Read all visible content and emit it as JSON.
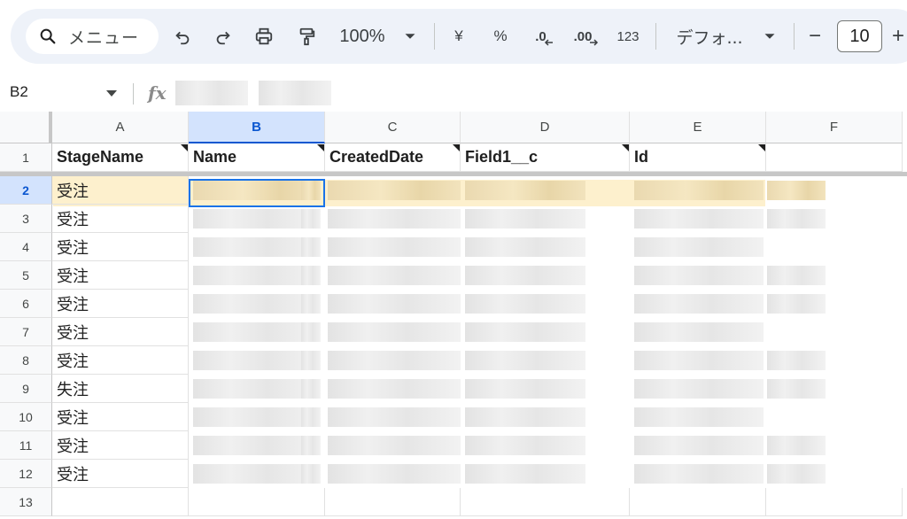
{
  "toolbar": {
    "menu_label": "メニュー",
    "zoom": "100%",
    "currency": "¥",
    "percent": "%",
    "dec_decrease": ".0",
    "dec_increase": ".00",
    "number_format": "123",
    "font": "デフォ...",
    "font_size": "10",
    "minus": "−",
    "plus": "+"
  },
  "formula_bar": {
    "cell_ref": "B2",
    "fx": "fx"
  },
  "columns": [
    "A",
    "B",
    "C",
    "D",
    "E",
    "F"
  ],
  "rows": [
    "1",
    "2",
    "3",
    "4",
    "5",
    "6",
    "7",
    "8",
    "9",
    "10",
    "11",
    "12",
    "13"
  ],
  "header_row": [
    "StageName",
    "Name",
    "CreatedDate",
    "Field1__c",
    "Id"
  ],
  "stage_values": [
    "受注",
    "受注",
    "受注",
    "受注",
    "受注",
    "受注",
    "受注",
    "失注",
    "受注",
    "受注",
    "受注"
  ],
  "selected_cell": "B2"
}
